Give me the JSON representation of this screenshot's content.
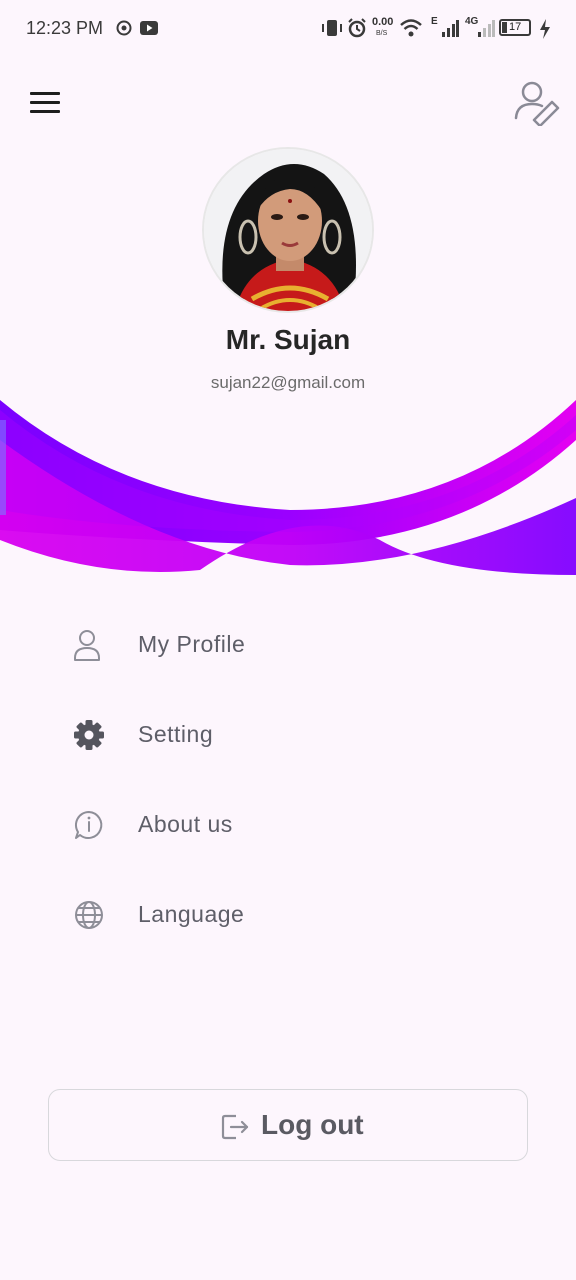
{
  "status_bar": {
    "time": "12:23 PM",
    "net_speed_value": "0.00",
    "net_speed_unit": "B/S",
    "network_e": "E",
    "network_4g": "4G",
    "battery": "17"
  },
  "profile": {
    "name": "Mr. Sujan",
    "email": "sujan22@gmail.com"
  },
  "menu": {
    "items": [
      {
        "label": "My Profile",
        "icon": "user-icon"
      },
      {
        "label": "Setting",
        "icon": "gear-icon"
      },
      {
        "label": "About us",
        "icon": "info-chat-icon"
      },
      {
        "label": "Language",
        "icon": "globe-icon"
      }
    ]
  },
  "logout": {
    "label": "Log out",
    "icon": "logout-icon"
  },
  "colors": {
    "background": "#fdf6fd",
    "wave_purple": "#8a00ff",
    "wave_magenta": "#e000f0"
  }
}
